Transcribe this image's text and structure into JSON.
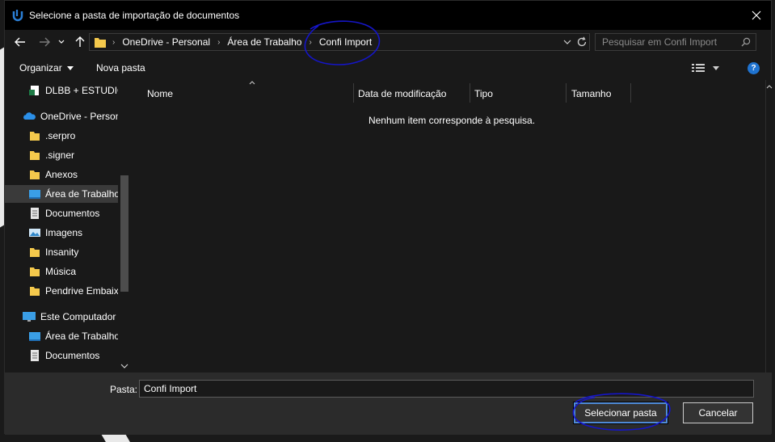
{
  "window": {
    "title": "Selecione a pasta de importação de documentos"
  },
  "address": {
    "breadcrumbs": [
      "OneDrive - Personal",
      "Área de Trabalho",
      "Confi Import"
    ]
  },
  "search": {
    "placeholder": "Pesquisar em Confi Import"
  },
  "toolbar": {
    "organize_label": "Organizar",
    "new_folder_label": "Nova pasta"
  },
  "nav": {
    "items": [
      {
        "label": "DLBB + ESTUDIO",
        "icon": "excel-file-icon",
        "indent": 1
      },
      {
        "label": "OneDrive - Personal",
        "icon": "onedrive-cloud-icon",
        "indent": 0
      },
      {
        "label": ".serpro",
        "icon": "folder-icon",
        "indent": 1
      },
      {
        "label": ".signer",
        "icon": "folder-icon",
        "indent": 1
      },
      {
        "label": "Anexos",
        "icon": "folder-icon",
        "indent": 1
      },
      {
        "label": "Área de Trabalho",
        "icon": "desktop-icon",
        "indent": 1,
        "selected": true
      },
      {
        "label": "Documentos",
        "icon": "documents-icon",
        "indent": 1
      },
      {
        "label": "Imagens",
        "icon": "pictures-icon",
        "indent": 1
      },
      {
        "label": "Insanity",
        "icon": "folder-icon",
        "indent": 1
      },
      {
        "label": "Música",
        "icon": "folder-icon",
        "indent": 1
      },
      {
        "label": "Pendrive Embaixo",
        "icon": "folder-icon",
        "indent": 1
      },
      {
        "label": "Este Computador",
        "icon": "computer-icon",
        "indent": 0
      },
      {
        "label": "Área de Trabalho",
        "icon": "desktop-icon",
        "indent": 1
      },
      {
        "label": "Documentos",
        "icon": "documents-icon",
        "indent": 1
      }
    ]
  },
  "columns": {
    "name": "Nome",
    "modified": "Data de modificação",
    "type": "Tipo",
    "size": "Tamanho"
  },
  "files": {
    "empty_message": "Nenhum item corresponde à pesquisa."
  },
  "bottom": {
    "folder_label": "Pasta:",
    "folder_value": "Confi Import",
    "select_button": "Selecionar pasta",
    "cancel_button": "Cancelar"
  },
  "colors": {
    "accent": "#1f73d0",
    "annotation": "#1515c8",
    "folder": "#f5c94c"
  }
}
